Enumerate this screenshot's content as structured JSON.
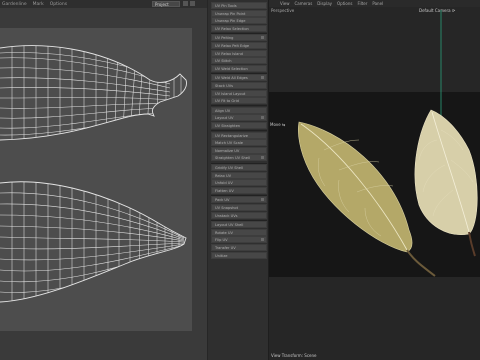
{
  "uv_panel": {
    "menu": [
      "Gardenline",
      "Mark",
      "Options"
    ],
    "projection_select": "Project"
  },
  "tools_panel": {
    "buttons": [
      "UV Pin Tools",
      "Unwrap Pin Point",
      "Unwrap Pin Edge",
      "UV Relax Selection",
      "UV Pelting",
      "UV Relax Pelt Edge",
      "UV Relax Island",
      "UV Stitch",
      "UV Weld Selection",
      "UV Weld All Edges",
      "Stack UVs",
      "UV Island Layout",
      "UV Fit to Grid",
      "Align UV",
      "Layout UV",
      "UV Straighten",
      "UV Rectangularize",
      "Match UV Scale",
      "Normalize UV",
      "Straighten UV Shell",
      "Gridify UV Shell",
      "Relax UV",
      "Unfold UV",
      "Flatten UV",
      "Pack UV",
      "UV Snapshot",
      "Unstack UVs",
      "Layout UV Shell",
      "Rotate UV",
      "Flip UV",
      "Transfer UV",
      "Unitize"
    ]
  },
  "viewport": {
    "menu": [
      "View",
      "Cameras",
      "Display",
      "Options",
      "Filter",
      "Panel"
    ],
    "title": "Perspective",
    "camera": "Default Camera ⟳",
    "move_label": "Move ⇆",
    "status": "View Transform: Scene"
  },
  "colors": {
    "uv_bg": "#4d4d4d",
    "uv_wire": "#e6e6e6",
    "viewport_band": "#161616",
    "leaf_fill": "#bfb27a",
    "axis_line": "#2aa07a"
  }
}
